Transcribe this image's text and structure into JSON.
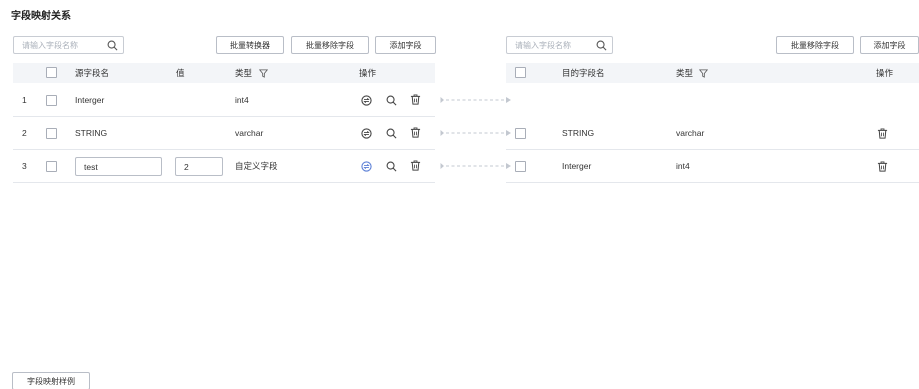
{
  "page_title": "字段映射关系",
  "left": {
    "search_placeholder": "请输入字段名称",
    "buttons": {
      "batch_convert": "批量转换器",
      "batch_remove": "批量移除字段",
      "add_field": "添加字段"
    },
    "headers": {
      "source_field": "源字段名",
      "value": "值",
      "type": "类型",
      "ops": "操作"
    },
    "rows": [
      {
        "index": "1",
        "field": "Interger",
        "value": "",
        "type": "int4"
      },
      {
        "index": "2",
        "field": "STRING",
        "value": "",
        "type": "varchar"
      },
      {
        "index": "3",
        "field": "test",
        "value": "2",
        "type": "自定义字段"
      }
    ]
  },
  "right": {
    "search_placeholder": "请输入字段名称",
    "buttons": {
      "batch_remove": "批量移除字段",
      "add_field": "添加字段"
    },
    "headers": {
      "target_field": "目的字段名",
      "type": "类型",
      "ops": "操作"
    },
    "rows": [
      {
        "field": "",
        "type": ""
      },
      {
        "field": "STRING",
        "type": "varchar"
      },
      {
        "field": "Interger",
        "type": "int4"
      }
    ]
  },
  "footer": {
    "example_button": "字段映射样例"
  },
  "icons": {
    "search": "search-icon",
    "filter": "filter-icon",
    "convert": "convert-icon",
    "view": "search-icon",
    "delete": "trash-icon",
    "connector": "dashed-arrow-icon"
  },
  "colors": {
    "accent": "#5b7fd6",
    "border": "#b9bec7",
    "header_bg": "#f3f5f8",
    "connector": "#c3c8d0"
  }
}
